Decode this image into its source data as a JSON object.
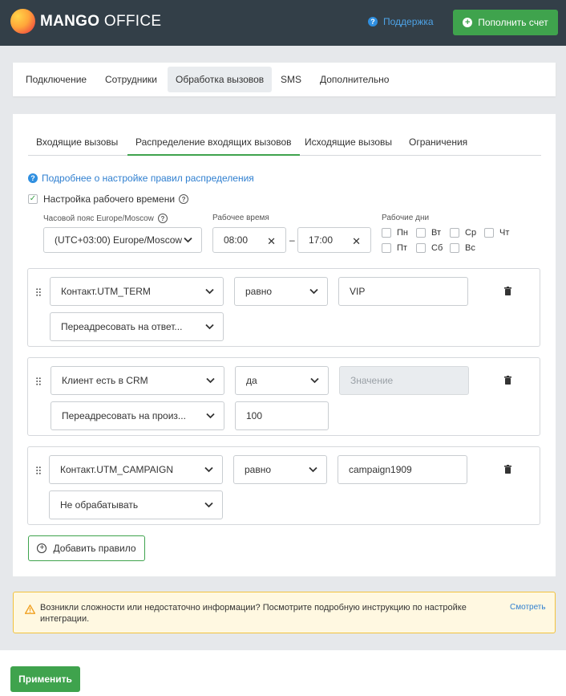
{
  "header": {
    "brand_bold": "MANGO",
    "brand_light": " OFFICE",
    "support_label": "Поддержка",
    "topup_label": "Пополнить счет",
    "colors": {
      "background": "#333f48",
      "accent": "#3fa34d",
      "link": "#4ea3e6"
    }
  },
  "main_tabs": [
    {
      "label": "Подключение"
    },
    {
      "label": "Сотрудники"
    },
    {
      "label": "Обработка вызовов"
    },
    {
      "label": "SMS"
    },
    {
      "label": "Дополнительно"
    }
  ],
  "active_main_tab": "Обработка вызовов",
  "sub_tabs": [
    {
      "label": "Входящие вызовы"
    },
    {
      "label": "Распределение входящих вызовов"
    },
    {
      "label": "Исходящие вызовы"
    },
    {
      "label": "Ограничения"
    }
  ],
  "active_sub_tab": "Распределение входящих вызовов",
  "info_link": "Подробнее о настройке правил распределения",
  "work_time": {
    "enabled": true,
    "label": "Настройка рабочего времени",
    "timezone_label": "Часовой пояс Europe/Moscow",
    "timezone_value": "(UTC+03:00) Europe/Moscow",
    "hours_label": "Рабочее время",
    "from": "08:00",
    "to": "17:00",
    "separator": "–",
    "days_label": "Рабочие дни",
    "days": [
      {
        "label": "Пн",
        "checked": false
      },
      {
        "label": "Вт",
        "checked": false
      },
      {
        "label": "Ср",
        "checked": false
      },
      {
        "label": "Чт",
        "checked": false
      },
      {
        "label": "Пт",
        "checked": false
      },
      {
        "label": "Сб",
        "checked": false
      },
      {
        "label": "Вс",
        "checked": false
      }
    ]
  },
  "rules": [
    {
      "field": "Контакт.UTM_TERM",
      "operator": "равно",
      "value": "VIP",
      "action": "Переадресовать на ответ..."
    },
    {
      "field": "Клиент есть в CRM",
      "operator": "да",
      "value": "",
      "value_placeholder": "Значение",
      "action": "Переадресовать на произ...",
      "extra_value": "100"
    },
    {
      "field": "Контакт.UTM_CAMPAIGN",
      "operator": "равно",
      "value": "campaign1909",
      "action": "Не обрабатывать"
    }
  ],
  "add_rule_label": "Добавить правило",
  "warning": {
    "text": "Возникли сложности или недостаточно информации? Посмотрите подробную инструкцию по настройке интеграции.",
    "link": "Смотреть"
  },
  "apply_label": "Применить"
}
